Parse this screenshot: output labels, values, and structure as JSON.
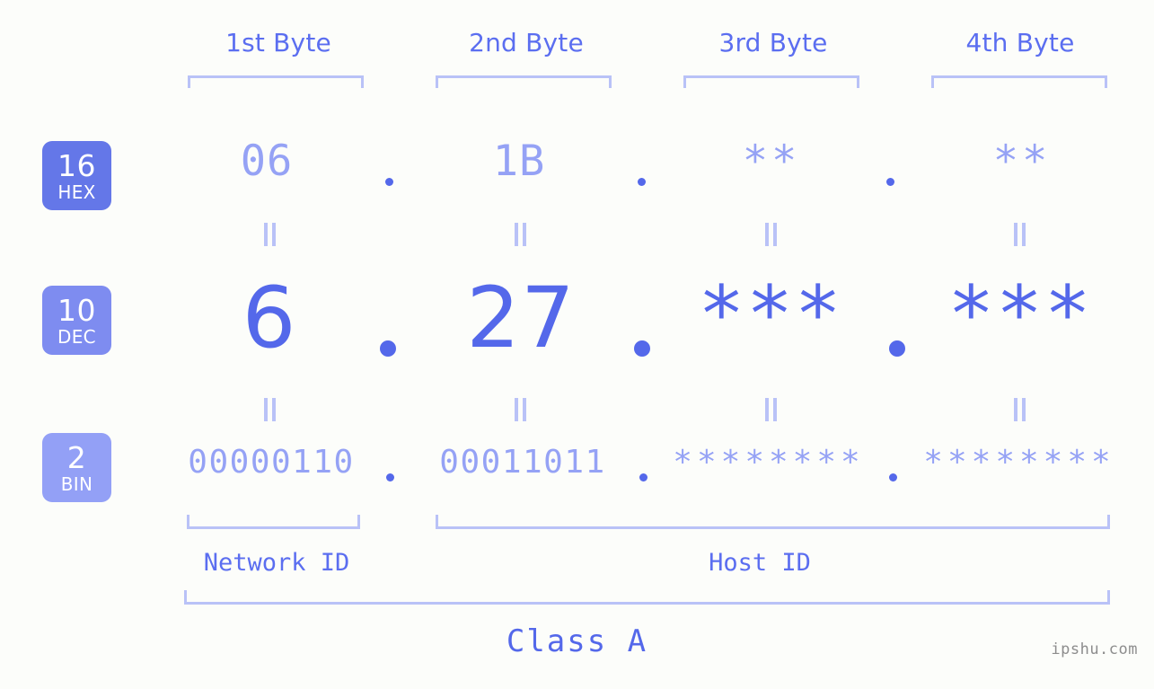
{
  "background_color": "#fcfdfa",
  "accent_color": "#5468ea",
  "muted_accent_color": "#95a2f5",
  "bracket_color": "#b9c2f7",
  "columns": {
    "headers": [
      "1st Byte",
      "2nd Byte",
      "3rd Byte",
      "4th Byte"
    ]
  },
  "bases": [
    {
      "number": "16",
      "label": "HEX",
      "badge_color": "#6477e8"
    },
    {
      "number": "10",
      "label": "DEC",
      "badge_color": "#7e8cf0"
    },
    {
      "number": "2",
      "label": "BIN",
      "badge_color": "#93a0f6"
    }
  ],
  "rows": {
    "hex": {
      "values": [
        "06",
        "1B",
        "**",
        "**"
      ]
    },
    "dec": {
      "values": [
        "6",
        "27",
        "***",
        "***"
      ]
    },
    "bin": {
      "values": [
        "00000110",
        "00011011",
        "********",
        "********"
      ]
    }
  },
  "separators": {
    "symbol": "."
  },
  "equivalence": {
    "symbol": "="
  },
  "segments": {
    "network_id": "Network ID",
    "host_id": "Host ID"
  },
  "class_label": "Class A",
  "watermark": "ipshu.com"
}
